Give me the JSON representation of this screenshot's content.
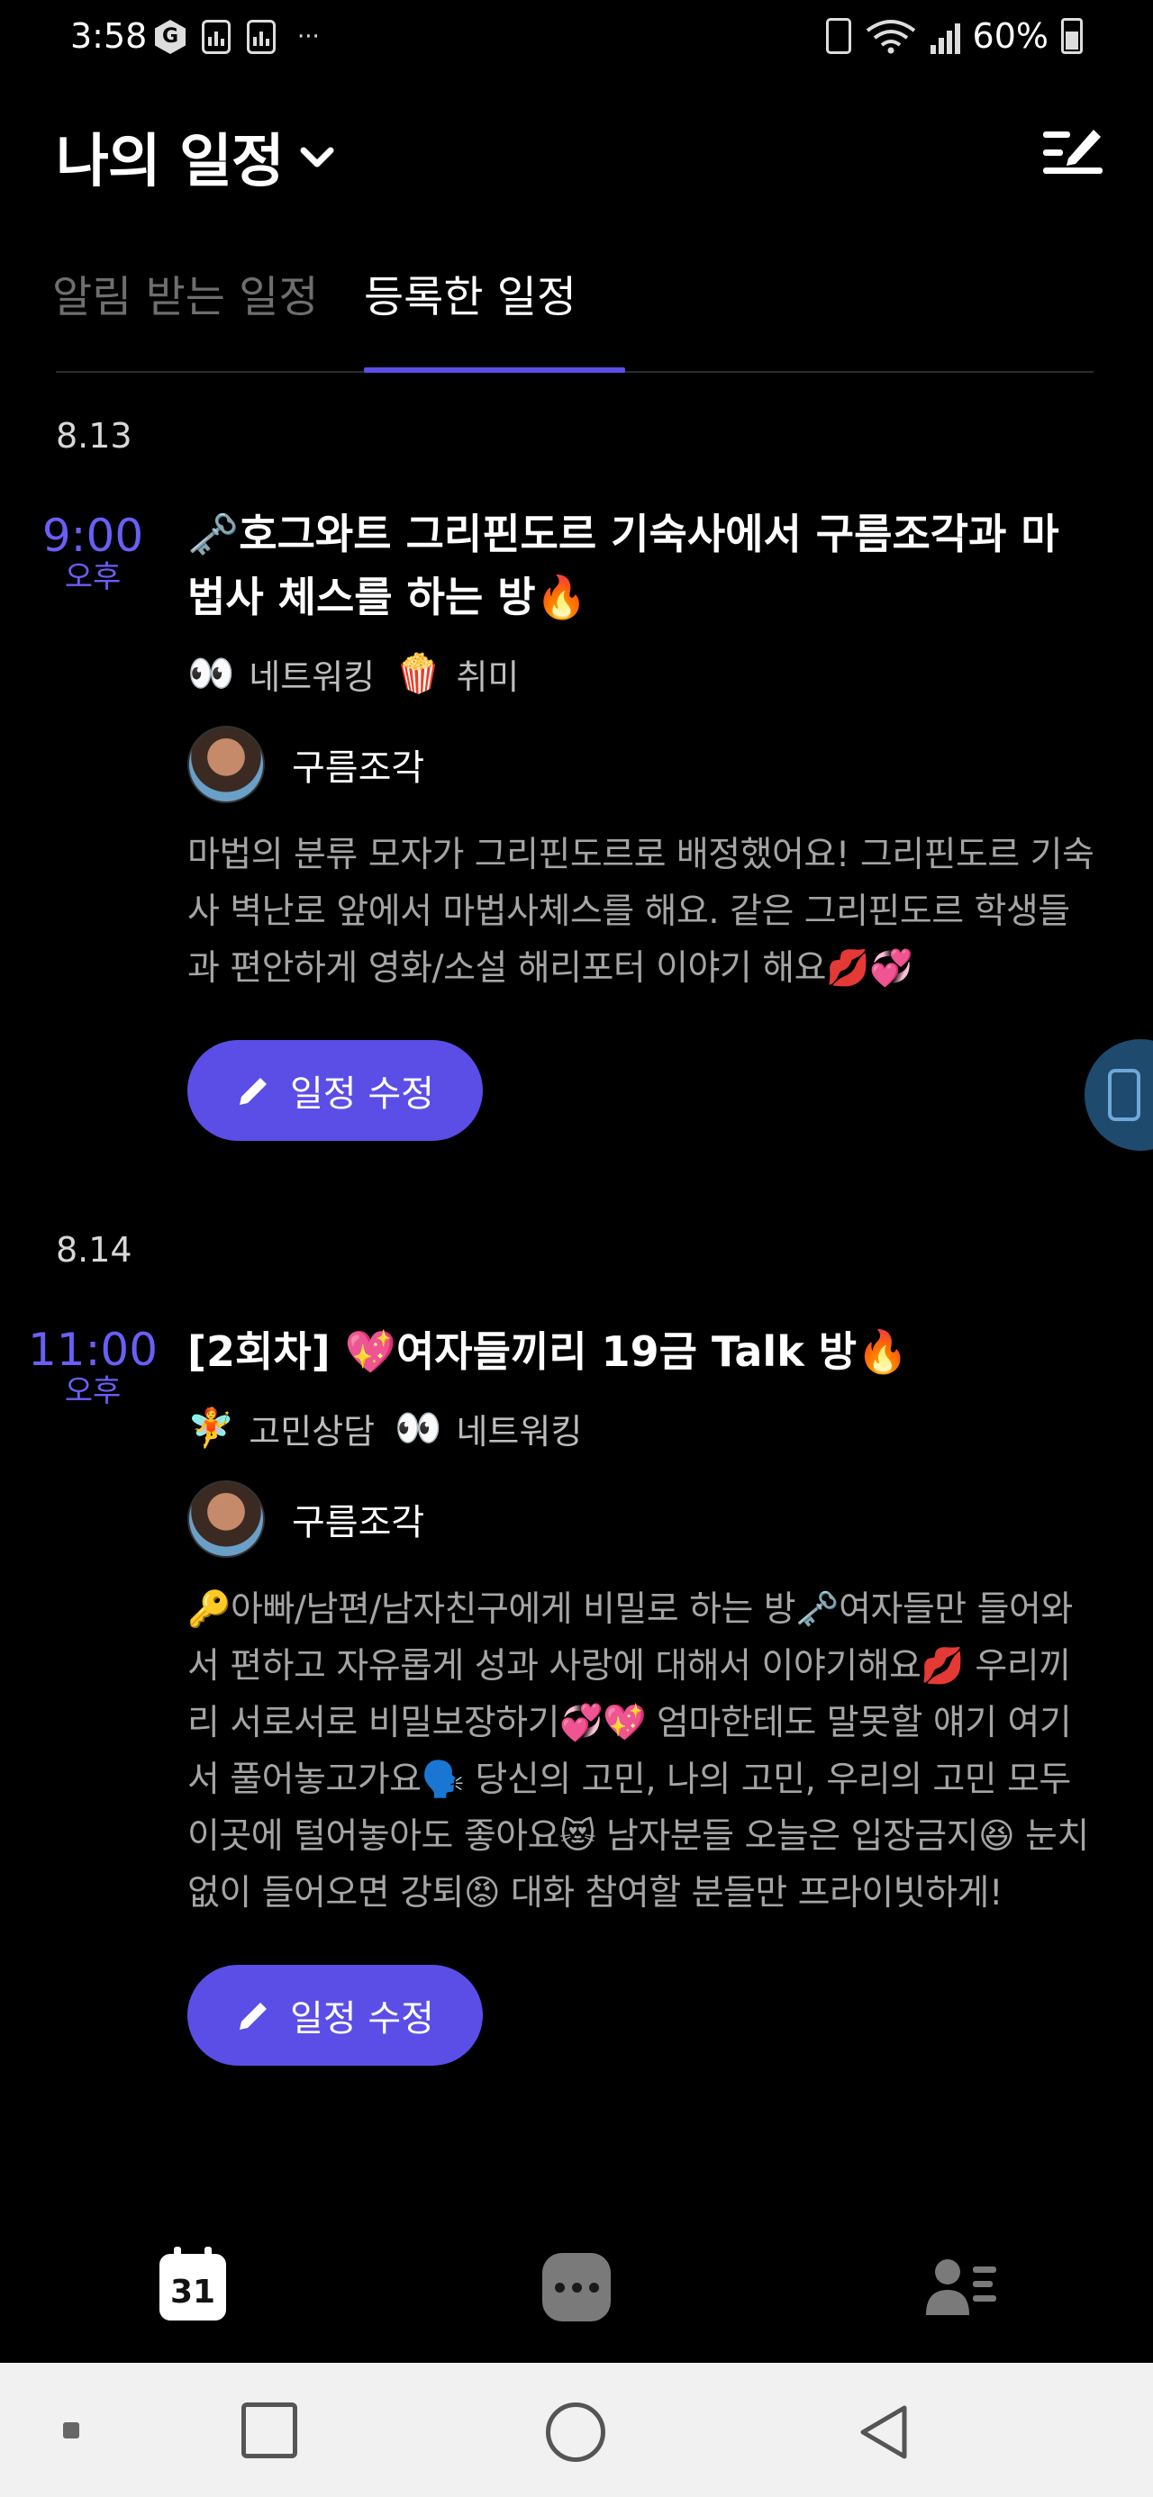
{
  "status_bar": {
    "time": "3:58",
    "battery": "60%",
    "more": "···",
    "network_badge": "G"
  },
  "header": {
    "title": "나의 일정"
  },
  "tabs": [
    {
      "label": "알림 받는 일정",
      "active": false
    },
    {
      "label": "등록한 일정",
      "active": true
    }
  ],
  "schedules": [
    {
      "date": "8.13",
      "time": "9:00",
      "ampm": "오후",
      "title": "🗝️호그와트 그리핀도르 기숙사에서 구름조각과 마법사 체스를 하는 방🔥",
      "tags": [
        {
          "emoji": "👀",
          "label": "네트워킹"
        },
        {
          "emoji": "🍿",
          "label": "취미"
        }
      ],
      "host": "구름조각",
      "description": "마법의 분류 모자가 그리핀도르로 배정했어요! 그리핀도르 기숙사 벽난로 앞에서 마법사체스를 해요. 같은 그리핀도르 학생들과 편안하게 영화/소설 해리포터 이야기 해요💋💞",
      "button": "일정 수정"
    },
    {
      "date": "8.14",
      "time": "11:00",
      "ampm": "오후",
      "title": "[2회차] 💖여자들끼리 19금 Talk 방🔥",
      "tags": [
        {
          "emoji": "🧚",
          "label": "고민상담"
        },
        {
          "emoji": "👀",
          "label": "네트워킹"
        }
      ],
      "host": "구름조각",
      "description": "🔑아빠/남편/남자친구에게 비밀로 하는 방🗝️여자들만 들어와서 편하고 자유롭게 성과 사랑에 대해서 이야기해요💋 우리끼리 서로서로 비밀보장하기💞💖 엄마한테도 말못할 얘기 여기서 풀어놓고가요🗣️ 당신의 고민, 나의 고민, 우리의 고민 모두 이곳에 털어놓아도 좋아요😻 남자분들 오늘은 입장금지😆 눈치없이 들어오면 강퇴😡 대화 참여할 분들만 프라이빗하게!",
      "button": "일정 수정"
    }
  ],
  "bottom_nav": {
    "calendar_day": "31"
  },
  "colors": {
    "accent": "#5b4ee6",
    "time": "#6b5ef5",
    "background": "#000000"
  }
}
